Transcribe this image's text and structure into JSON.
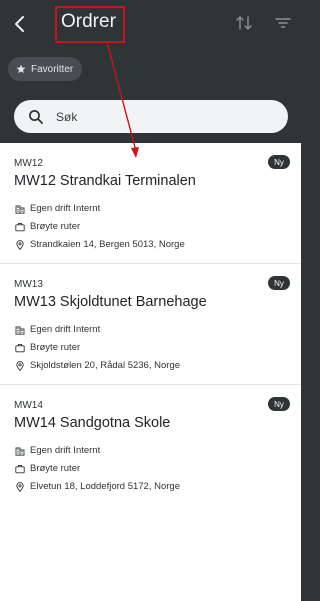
{
  "header": {
    "title": "Ordrer",
    "back_icon": "chevron-left-icon",
    "sort_icon": "sort-arrows-icon",
    "filter_icon": "filter-icon"
  },
  "favorites_chip": {
    "icon": "star-icon",
    "label": "Favoritter"
  },
  "search": {
    "icon": "search-icon",
    "placeholder": "Søk",
    "value": ""
  },
  "orders": [
    {
      "code": "MW12",
      "badge": "Ny",
      "name": "MW12 Strandkai Terminalen",
      "department": "Egen drift Internt",
      "route": "Brøyte ruter",
      "address": "Strandkaien 14, Bergen 5013, Norge"
    },
    {
      "code": "MW13",
      "badge": "Ny",
      "name": "MW13 Skjoldtunet Barnehage",
      "department": "Egen drift Internt",
      "route": "Brøyte ruter",
      "address": "Skjoldstølen 20, Rådal 5236, Norge"
    },
    {
      "code": "MW14",
      "badge": "Ny",
      "name": "MW14 Sandgotna Skole",
      "department": "Egen drift Internt",
      "route": "Brøyte ruter",
      "address": "Elvetun 18, Loddefjord 5172, Norge"
    }
  ],
  "colors": {
    "header_bg": "#2f3437",
    "annotation_red": "#c8141c",
    "badge_bg": "#2f3437",
    "list_bg": "#ffffff"
  }
}
